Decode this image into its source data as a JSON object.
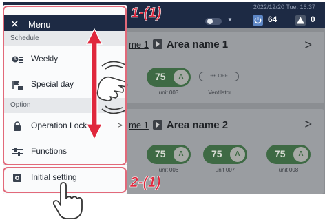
{
  "header": {
    "datetime": "2022/12/20 Tue. 16:37",
    "power_count": "64",
    "alert_count": "0"
  },
  "menu": {
    "title": "Menu",
    "sections": [
      {
        "label": "Schedule"
      },
      {
        "label": "Option"
      }
    ],
    "items": [
      {
        "label": "Weekly",
        "icon": "weekly-schedule-icon"
      },
      {
        "label": "Special day",
        "icon": "special-day-icon"
      },
      {
        "label": "Operation Lock",
        "icon": "lock-icon"
      },
      {
        "label": "Functions",
        "icon": "functions-icon"
      },
      {
        "label": "Initial setting",
        "icon": "gear-icon"
      }
    ]
  },
  "areas": [
    {
      "prefix": "me 1",
      "name": "Area name 1",
      "units": [
        {
          "temp": "75",
          "mode": "A",
          "label": "unit 003"
        }
      ],
      "ventilator": {
        "state": "OFF",
        "label": "Ventilator"
      }
    },
    {
      "prefix": "me 1",
      "name": "Area name 2",
      "units": [
        {
          "temp": "75",
          "mode": "A",
          "label": "unit 006"
        },
        {
          "temp": "75",
          "mode": "A",
          "label": "unit 007"
        },
        {
          "temp": "75",
          "mode": "A",
          "label": "unit 008"
        }
      ]
    }
  ],
  "annotations": {
    "step1": "1-(1)",
    "step2": "2-(1)"
  },
  "colors": {
    "header_bg": "#1d2a44",
    "highlight_frame": "#e2697a",
    "step_text": "#e0273c",
    "unit_green": "#3e6a44"
  }
}
